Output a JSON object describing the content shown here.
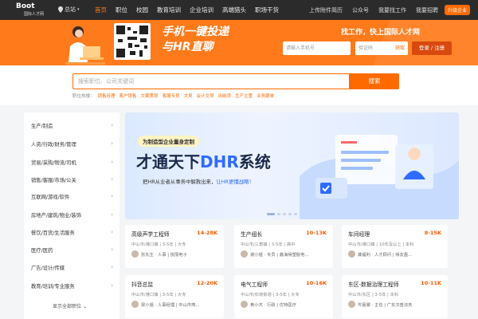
{
  "topbar": {
    "brand": "Boot",
    "brand_sub": "国际人才网",
    "location": "总站",
    "nav": [
      "首页",
      "职位",
      "校园",
      "教育培训",
      "企业培训",
      "高端猎头",
      "职场干货"
    ],
    "right": [
      "上传附件简历",
      "公众号",
      "我要找工作",
      "我要招聘"
    ],
    "pill": "升级企业"
  },
  "banner": {
    "slogan_line1": "手机一键投递",
    "slogan_line2": "与HR直聊",
    "promo": "找工作，快上国际人才网",
    "phone_placeholder": "请输入手机号",
    "code_placeholder": "验证码",
    "get_code": "获取",
    "login_label": "登录 / 注册"
  },
  "search": {
    "placeholder": "搜索职位、公司关键词",
    "button": "搜索",
    "hot_label": "职位热搜：",
    "hot": [
      "销售经理",
      "客户销售",
      "文案策划",
      "客服专员",
      "文员",
      "会计文员",
      "出纳员",
      "生产主管",
      "业务跟单"
    ]
  },
  "categories": [
    "生产/制造",
    "人资/行政/财务/管理",
    "贸易/采购/物流/司机",
    "销售/客服/市场/公关",
    "互联网/游戏/软件",
    "房地产/建筑/物业/装饰",
    "餐饮/百货/生活服务",
    "医疗/医药",
    "广告/设计/传媒",
    "教育/培训/专业服务"
  ],
  "categories_all": "显示全部职位",
  "hero": {
    "tag": "为制造型企业量身定制",
    "title_a": "才通天下",
    "title_b": "DHR",
    "title_c": "系统",
    "desc_a": "把HR从业者从事务中解救出来，",
    "desc_b": "让HR更懂战略！"
  },
  "jobs": [
    {
      "title": "高级声学工程师",
      "salary": "14-28K",
      "meta": "中山市/港口镇  |  3-5年  |  大专",
      "hr": "张先生 · 人事  |  悦丽电子"
    },
    {
      "title": "生产组长",
      "salary": "10-13K",
      "meta": "中山市/三角镇  |  3-5年  |  高中",
      "hr": "谢小姐 · 专员  |  鑫海得塑胶电..."
    },
    {
      "title": "车间经理",
      "salary": "8-15K",
      "meta": "中山市/港口镇  |  10年及以上  |  本科",
      "hr": "龚福利 · 人才顾问  |  得友盈..."
    },
    {
      "title": "抖音总监",
      "salary": "12-20K",
      "meta": "中山市/港口镇  |  3-5年  |  大专",
      "hr": "梁小姐 · 人事经理  |  中山市燕..."
    },
    {
      "title": "电气工程师",
      "salary": "10-16K",
      "meta": "中山市/石岐街道  |  3-5年  |  大专",
      "hr": "黄小杰 · 行政  |  优特医疗"
    },
    {
      "title": "东区-数据治理工程师",
      "salary": "10-11K",
      "meta": "中山市/东区  |  3-5年  |  本科",
      "hr": "岑嘉娜 · 主任  |  广东汉普法务"
    }
  ]
}
